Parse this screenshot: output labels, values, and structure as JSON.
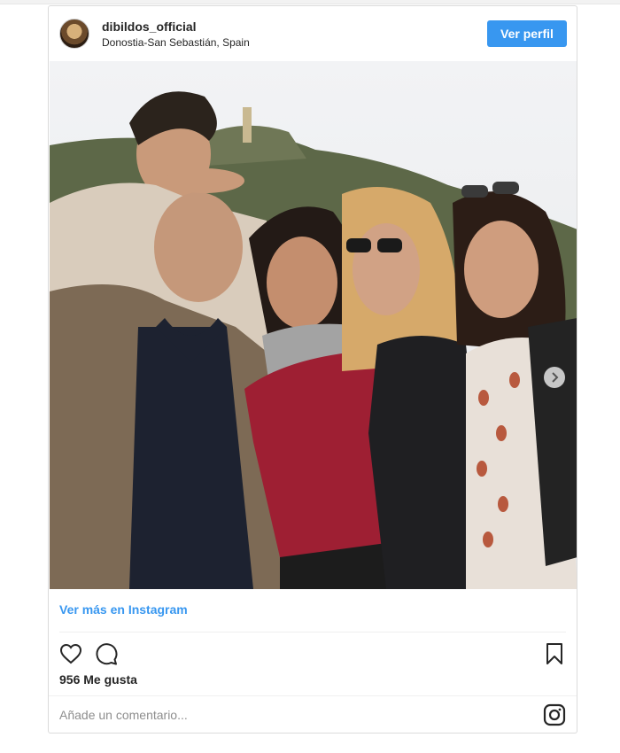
{
  "post": {
    "username": "dibildos_official",
    "location": "Donostia-San Sebastián, Spain",
    "profile_button": "Ver perfil",
    "more_link": "Ver más en Instagram",
    "likes": "956 Me gusta",
    "comment_placeholder": "Añade un comentario..."
  },
  "icons": {
    "like": "heart-icon",
    "comment": "comment-icon",
    "save": "bookmark-icon",
    "instagram": "instagram-logo-icon",
    "next": "chevron-right-icon"
  },
  "colors": {
    "accent": "#3897f0",
    "border": "#dbdbdb",
    "text": "#262626",
    "muted": "#8e8e8e"
  }
}
